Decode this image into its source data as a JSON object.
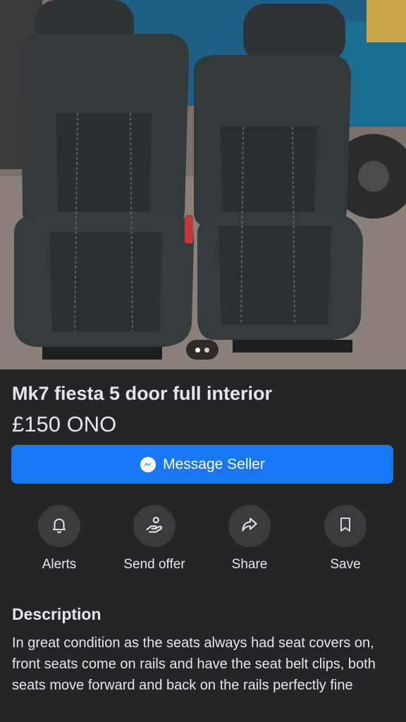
{
  "listing": {
    "title": "Mk7 fiesta 5 door full interior",
    "price": "£150 ONO",
    "photo": {
      "description_icon": "car-seats-photo",
      "carousel_pages": 2,
      "carousel_active_index": 0
    }
  },
  "message_button": {
    "label": "Message Seller",
    "icon": "messenger-icon",
    "color": "#1877f2"
  },
  "actions": [
    {
      "label": "Alerts",
      "icon": "bell-icon"
    },
    {
      "label": "Send offer",
      "icon": "offer-icon"
    },
    {
      "label": "Share",
      "icon": "share-icon"
    },
    {
      "label": "Save",
      "icon": "bookmark-icon"
    }
  ],
  "description": {
    "heading": "Description",
    "text": "In great condition as the seats always had seat covers on, front seats come on rails and have the seat belt clips, both seats move forward and back on the rails perfectly fine"
  },
  "theme": {
    "background": "#242526",
    "circle_background": "#3a3b3c",
    "text": "#e4e6eb"
  }
}
